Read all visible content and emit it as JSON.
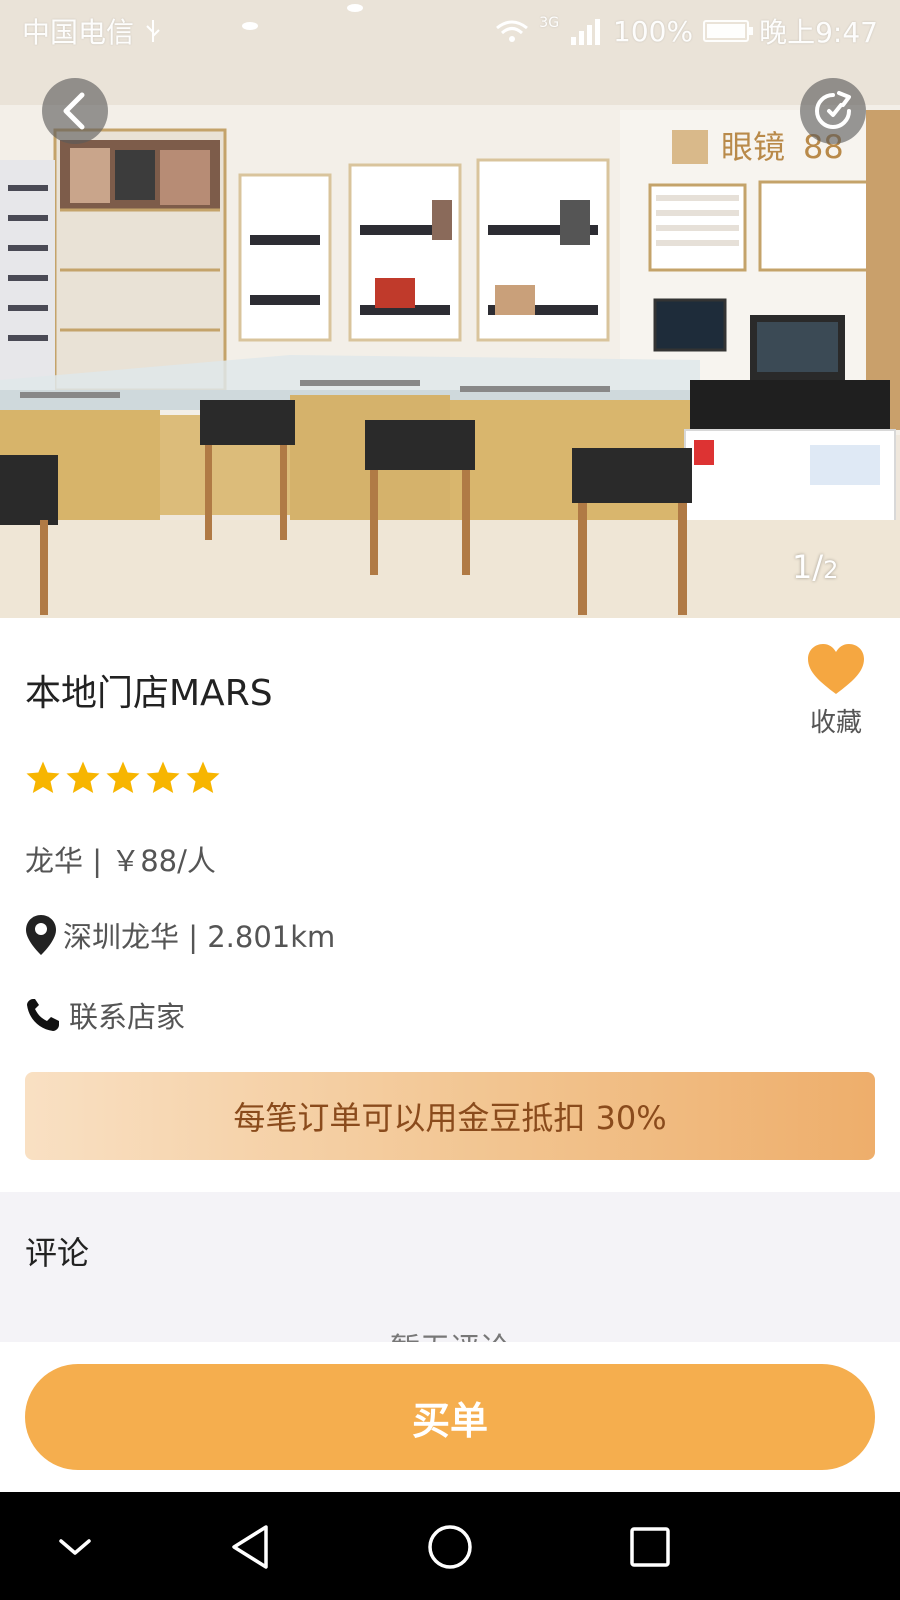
{
  "status_bar": {
    "carrier": "中国电信",
    "network": "3G",
    "battery": "100%",
    "time": "晚上9:47"
  },
  "hero": {
    "store_sign": "眼镜",
    "sign_number": "88",
    "page_current": "1",
    "page_separator": "/",
    "page_total": "2"
  },
  "shop": {
    "name": "本地门店MARS",
    "favorite_label": "收藏",
    "rating": 5,
    "area_price": "龙华 | ￥88/人",
    "location": "深圳龙华 | 2.801km",
    "contact": "联系店家"
  },
  "promo": {
    "text": "每笔订单可以用金豆抵扣 30%"
  },
  "reviews": {
    "title": "评论",
    "empty_text": "暂无评论"
  },
  "actions": {
    "buy_label": "买单"
  },
  "colors": {
    "accent": "#f5ae4e",
    "star": "#f7b500",
    "heart": "#f5a741",
    "promo_text": "#8a4b1c"
  },
  "icons": [
    "back-icon",
    "refresh-icon",
    "heart-icon",
    "star-icon",
    "location-pin-icon",
    "phone-icon",
    "nav-down-icon",
    "nav-back-icon",
    "nav-home-icon",
    "nav-recent-icon"
  ]
}
